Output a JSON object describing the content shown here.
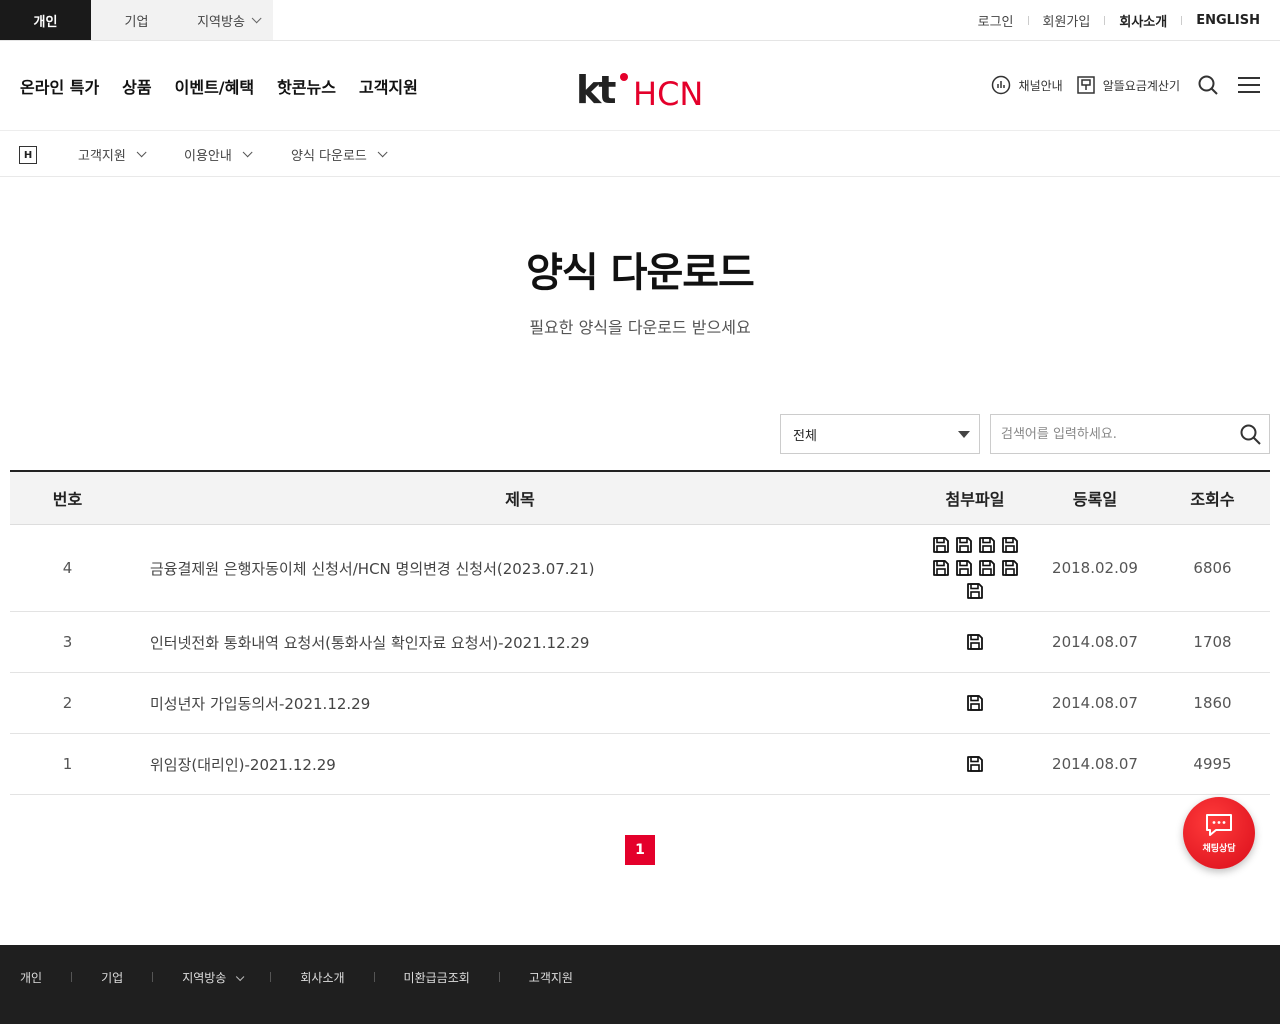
{
  "topbar": {
    "tabs": [
      {
        "label": "개인",
        "active": true
      },
      {
        "label": "기업",
        "active": false
      },
      {
        "label": "지역방송",
        "active": false
      }
    ],
    "links": [
      "로그인",
      "회원가입",
      "회사소개",
      "ENGLISH"
    ]
  },
  "gnb": {
    "menu": [
      "온라인 특가",
      "상품",
      "이벤트/혜택",
      "핫콘뉴스",
      "고객지원"
    ],
    "logo": {
      "kt": "kt",
      "brand": "HCN"
    },
    "channel_guide": "채널안내",
    "fee_calculator": "알뜰요금계산기"
  },
  "breadcrumb": {
    "home_glyph": "H",
    "items": [
      "고객지원",
      "이용안내",
      "양식 다운로드"
    ]
  },
  "page": {
    "title": "양식 다운로드",
    "subtitle": "필요한 양식을 다운로드 받으세요"
  },
  "filter": {
    "selected": "전체",
    "search_placeholder": "검색어를 입력하세요."
  },
  "table": {
    "headers": {
      "no": "번호",
      "title": "제목",
      "file": "첨부파일",
      "date": "등록일",
      "views": "조회수"
    },
    "rows": [
      {
        "no": "4",
        "title": "금융결제원 은행자동이체 신청서/HCN 명의변경 신청서(2023.07.21)",
        "file_count": 9,
        "date": "2018.02.09",
        "views": "6806"
      },
      {
        "no": "3",
        "title": "인터넷전화 통화내역 요청서(통화사실 확인자료 요청서)-2021.12.29",
        "file_count": 1,
        "date": "2014.08.07",
        "views": "1708"
      },
      {
        "no": "2",
        "title": "미성년자 가입동의서-2021.12.29",
        "file_count": 1,
        "date": "2014.08.07",
        "views": "1860"
      },
      {
        "no": "1",
        "title": "위임장(대리인)-2021.12.29",
        "file_count": 1,
        "date": "2014.08.07",
        "views": "4995"
      }
    ]
  },
  "pagination": {
    "current": "1"
  },
  "chat": {
    "label": "채팅상담"
  },
  "footer": {
    "nav": [
      "개인",
      "기업",
      "지역방송",
      "회사소개",
      "미환급금조회",
      "고객지원"
    ]
  },
  "colors": {
    "brand_red": "#e4002b",
    "dark": "#1f1f1f"
  }
}
